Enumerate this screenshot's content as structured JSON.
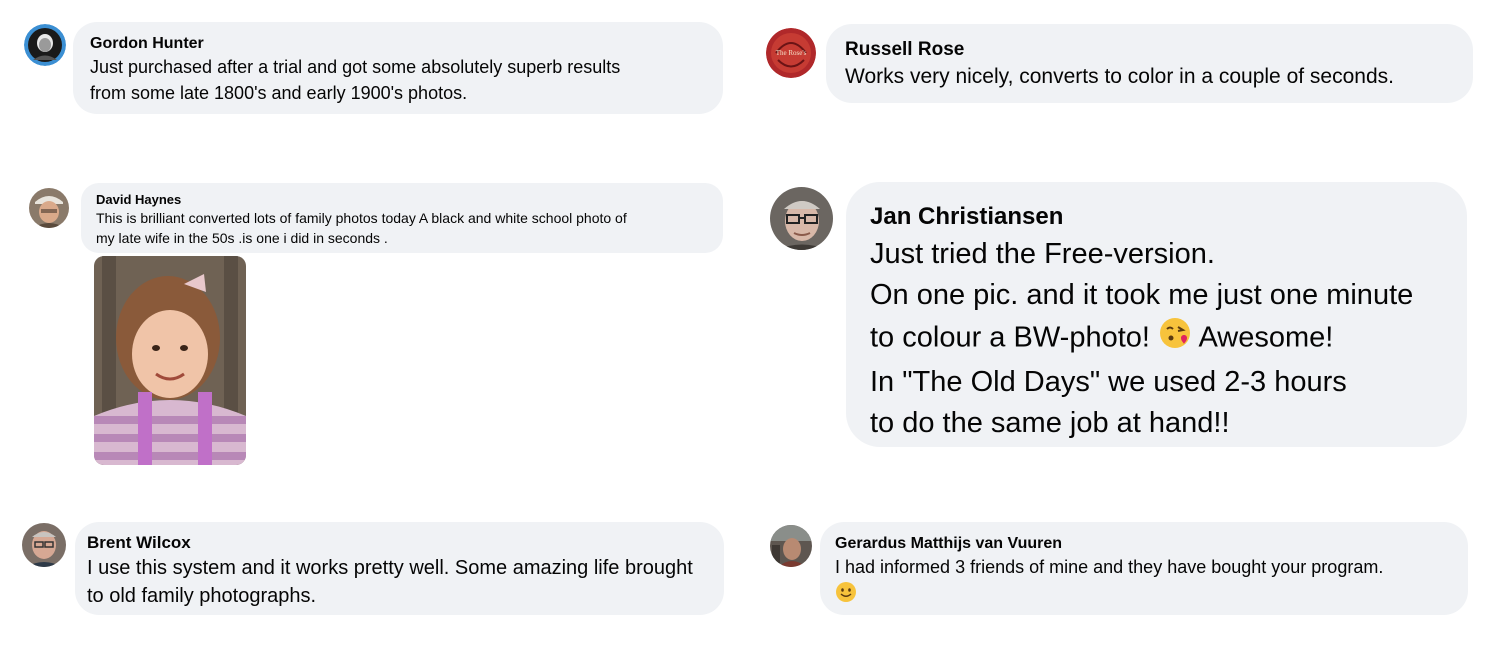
{
  "comments": [
    {
      "author": "Gordon Hunter",
      "lines": [
        "Just purchased after a trial and got some absolutely superb results",
        "from some late 1800's and early 1900's photos."
      ],
      "avatar": "avatar-dark-portrait"
    },
    {
      "author": "Russell Rose",
      "lines": [
        "Works very nicely, converts to color in a couple of seconds."
      ],
      "avatar": "avatar-red-logo",
      "avatar_text": "The Rose's"
    },
    {
      "author": "David Haynes",
      "lines": [
        "This is brilliant converted lots of family photos today A black and white school photo of",
        "my late wife in the 50s .is one i did in seconds ."
      ],
      "avatar": "avatar-man-cap",
      "attachment": "colorized-school-photo"
    },
    {
      "author": "Jan Christiansen",
      "lines": [
        "Just tried the Free-version.",
        "On one pic. and it took me just one minute",
        "to colour a BW-photo!",
        " Awesome!",
        "In \"The Old Days\" we used 2-3 hours",
        "to do the same job at hand!!"
      ],
      "avatar": "avatar-man-glasses",
      "emoji": "face-blowing-kiss-emoji"
    },
    {
      "author": "Brent Wilcox",
      "lines": [
        "I use this system and it works pretty well. Some amazing life brought",
        "to old family photographs."
      ],
      "avatar": "avatar-older-man"
    },
    {
      "author": "Gerardus Matthijs van Vuuren",
      "lines": [
        "I had informed 3 friends of mine and they have bought your program."
      ],
      "avatar": "avatar-man-outdoors",
      "emoji": "smiling-face-emoji"
    }
  ],
  "colors": {
    "bubble": "#f0f2f5",
    "text": "#050505",
    "emoji_yellow": "#f7c33c"
  }
}
